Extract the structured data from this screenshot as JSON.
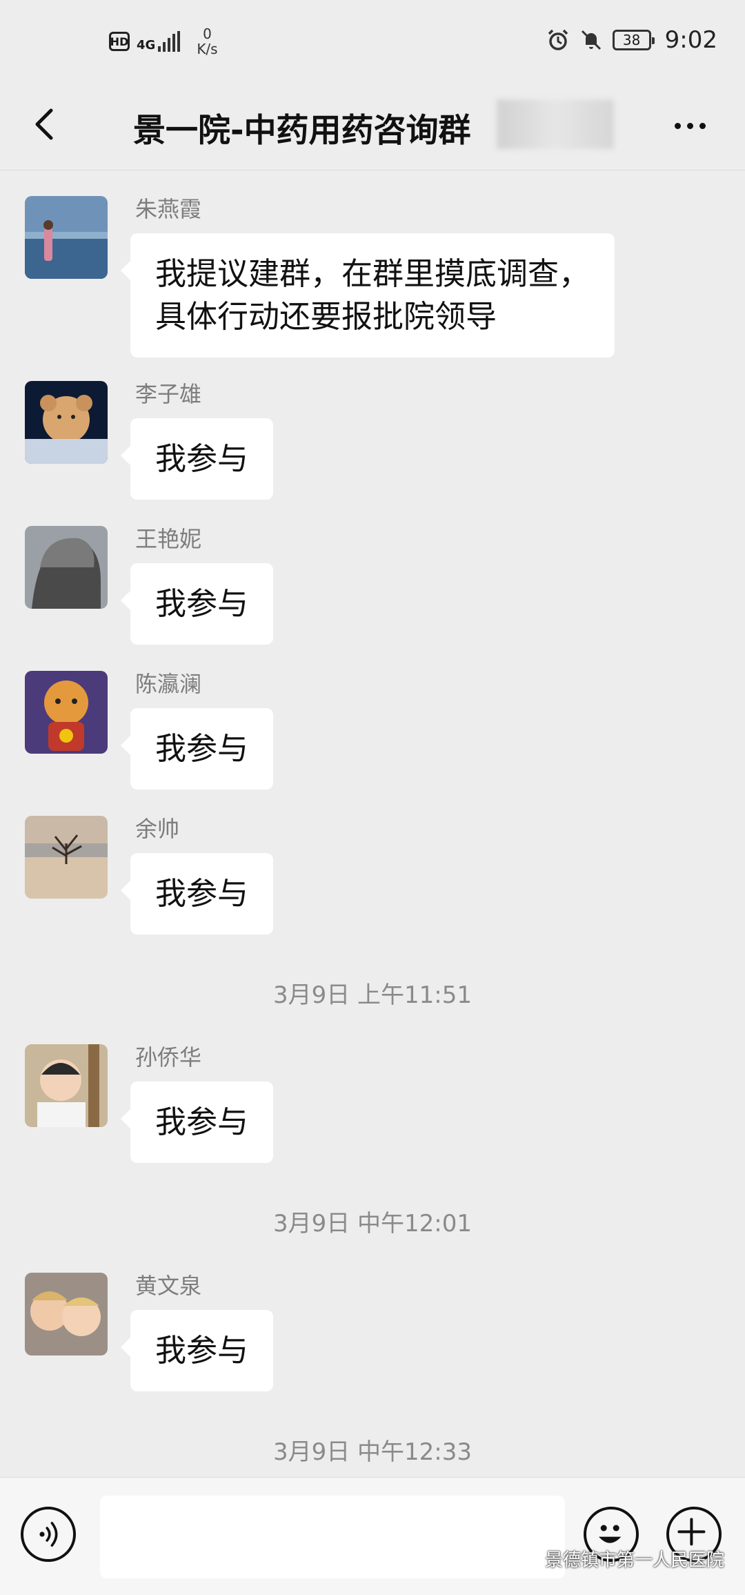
{
  "status_bar": {
    "hd": "HD",
    "network": "4G",
    "speed_value": "0",
    "speed_unit": "K/s",
    "battery": "38",
    "time": "9:02"
  },
  "nav": {
    "title": "景一院-中药用药咨询群"
  },
  "messages": [
    {
      "sender": "朱燕霞",
      "text_line1": "我提议建群，在群里摸底调查，",
      "text_line2": "具体行动还要报批院领导"
    },
    {
      "sender": "李子雄",
      "text": "我参与"
    },
    {
      "sender": "王艳妮",
      "text": "我参与"
    },
    {
      "sender": "陈瀛澜",
      "text": "我参与"
    },
    {
      "sender": "余帅",
      "text": "我参与"
    },
    {
      "sender": "孙侨华",
      "text": "我参与"
    },
    {
      "sender": "黄文泉",
      "text": "我参与"
    }
  ],
  "timestamps": [
    "3月9日 上午11:51",
    "3月9日 中午12:01",
    "3月9日 中午12:33"
  ],
  "watermark": "景德镇市第一人民医院",
  "icons": {
    "back": "chevron-left-icon",
    "more": "more-dots-icon",
    "voice": "voice-icon",
    "emoji": "emoji-icon",
    "plus": "plus-icon",
    "alarm": "alarm-icon",
    "mute": "bell-off-icon"
  },
  "colors": {
    "chat_background": "#ededed",
    "bubble": "#ffffff",
    "sender_name": "#7d7d7d",
    "timestamp": "#8a8a8a"
  }
}
